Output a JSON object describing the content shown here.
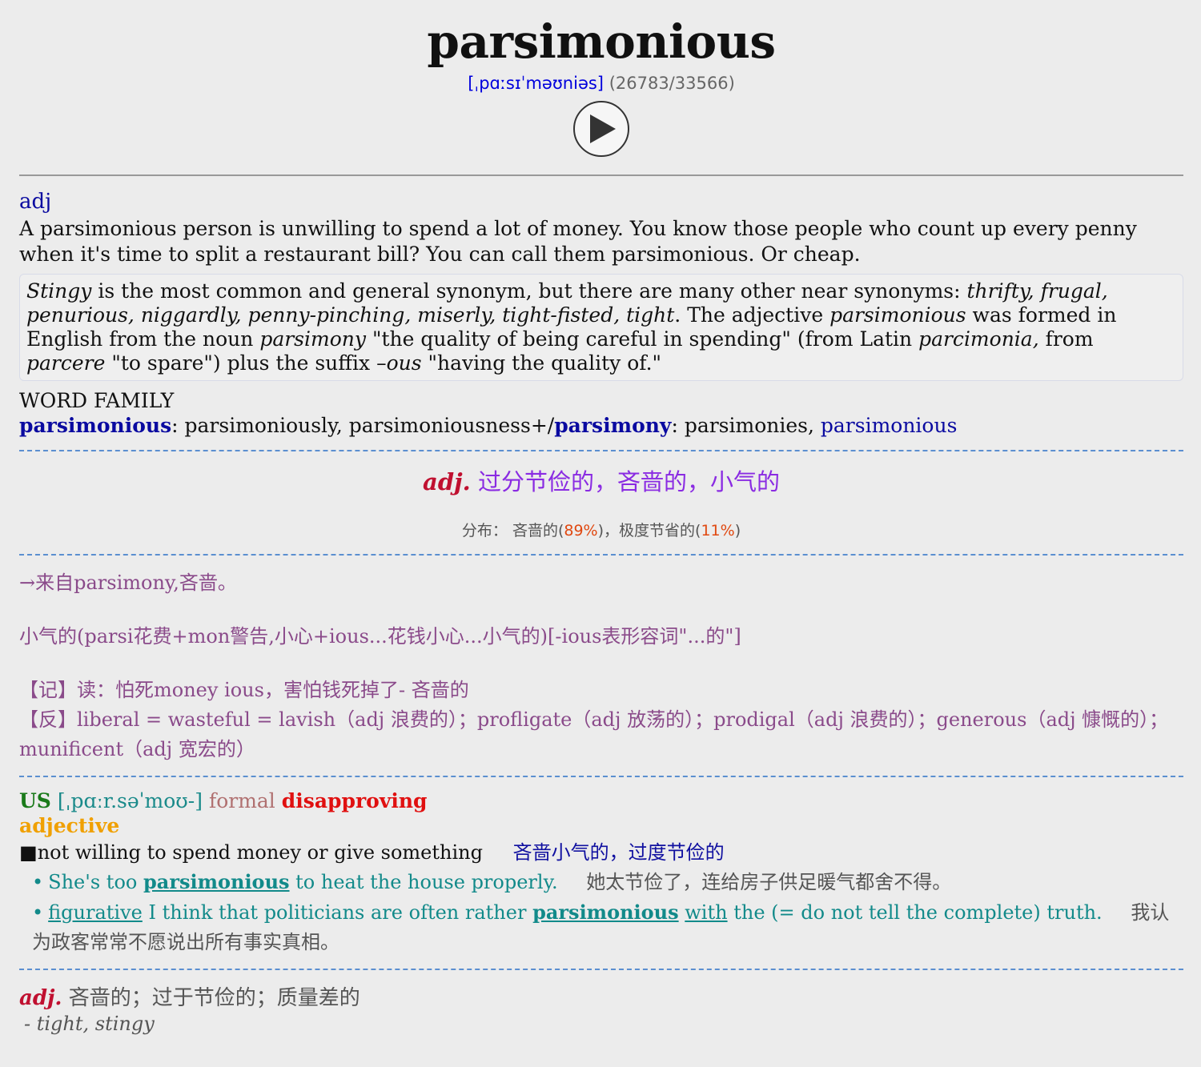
{
  "headword": "parsimonious",
  "phonetic": "[ˌpɑːsɪˈməʊniəs]",
  "rank": "(26783/33566)",
  "play_icon": "play-icon",
  "section1": {
    "pos": "adj",
    "definition": "A parsimonious person is unwilling to spend a lot of money. You know those people who count up every penny when it's time to split a restaurant bill? You can call them parsimonious. Or cheap.",
    "note": {
      "t1": "Stingy",
      "t2": " is the most common and general synonym, but there are many other near synonyms: ",
      "t3": "thrifty, frugal, penurious, niggardly, penny-pinching, miserly, tight-fisted, tight",
      "t4": ". The adjective ",
      "t5": "parsimonious",
      "t6": " was formed in English from the noun ",
      "t7": "parsimony",
      "t8": " \"the quality of being careful in spending\" (from Latin ",
      "t9": "parcimonia,",
      "t10": " from ",
      "t11": "parcere",
      "t12": " \"to spare\") plus the suffix –",
      "t13": "ous",
      "t14": " \"having the quality of.\""
    },
    "word_family_title": "WORD FAMILY",
    "wf_head1": "parsimonious",
    "wf_text1": ": parsimoniously, parsimoniousness+/",
    "wf_head2": "parsimony",
    "wf_text2": ": parsimonies, ",
    "wf_link": "parsimonious"
  },
  "section2": {
    "pos": "adj.",
    "meaning": "过分节俭的，吝啬的，小气的",
    "distrib_label": "分布：",
    "d1_text": "吝啬的(",
    "d1_pct": "89%",
    "d1_end": ")，",
    "d2_text": "极度节省的(",
    "d2_pct": "11%",
    "d2_end": ")"
  },
  "section3": {
    "line1": "→来自parsimony,吝啬。",
    "line2": "小气的(parsi花费+mon警告,小心+ious...花钱小心...小气的)[-ious表形容词\"...的\"]",
    "line3": "【记】读：怕死money ious，害怕钱死掉了-  吝啬的",
    "line4": "【反】liberal = wasteful = lavish（adj 浪费的）；profligate（adj 放荡的）；prodigal（adj 浪费的）；generous（adj 慷慨的）；munificent（adj 宽宏的）"
  },
  "section4": {
    "us": "US",
    "phonetic": "[ˌpɑːr.səˈmoʊ-]",
    "formal": "formal",
    "disapproving": "disapproving",
    "pos": "adjective",
    "sense_bullet": "■",
    "sense": "not willing to spend money or give something",
    "sense_cn": "吝啬小气的，过度节俭的",
    "ex1_a": "She's too ",
    "ex1_b": "parsimonious",
    "ex1_c": " to heat the house properly.",
    "ex1_cn": "她太节俭了，连给房子供足暖气都舍不得。",
    "ex2_a": "figurative",
    "ex2_b": " I think that politicians are often rather ",
    "ex2_c": "parsimonious",
    "ex2_d": "with",
    "ex2_e": " the (= do not tell the complete) truth.",
    "ex2_cn": "我认为政客常常不愿说出所有事实真相。"
  },
  "section5": {
    "pos": "adj.",
    "meaning": "吝啬的；过于节俭的；质量差的",
    "synonyms": "- tight, stingy"
  }
}
